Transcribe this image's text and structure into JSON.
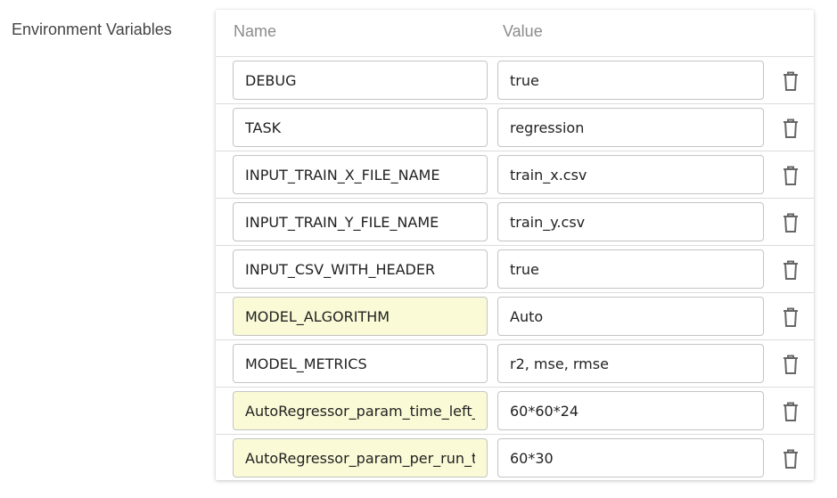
{
  "section": {
    "label": "Environment Variables"
  },
  "table": {
    "columns": {
      "name": "Name",
      "value": "Value"
    },
    "rows": [
      {
        "name": "DEBUG",
        "value": "true",
        "autofill": false
      },
      {
        "name": "TASK",
        "value": "regression",
        "autofill": false
      },
      {
        "name": "INPUT_TRAIN_X_FILE_NAME",
        "value": "train_x.csv",
        "autofill": false
      },
      {
        "name": "INPUT_TRAIN_Y_FILE_NAME",
        "value": "train_y.csv",
        "autofill": false
      },
      {
        "name": "INPUT_CSV_WITH_HEADER",
        "value": "true",
        "autofill": false
      },
      {
        "name": "MODEL_ALGORITHM",
        "value": "Auto",
        "autofill": true
      },
      {
        "name": "MODEL_METRICS",
        "value": "r2, mse, rmse",
        "autofill": false
      },
      {
        "name": "AutoRegressor_param_time_left_for_this_task",
        "value": "60*60*24",
        "autofill": true
      },
      {
        "name": "AutoRegressor_param_per_run_time_limit",
        "value": "60*30",
        "autofill": true
      }
    ],
    "delete_icon": "trash-icon"
  },
  "colors": {
    "autofill_background": "#fafad6",
    "border": "#c4c4c4",
    "header_text": "#8c8c8c",
    "icon": "#666666"
  }
}
